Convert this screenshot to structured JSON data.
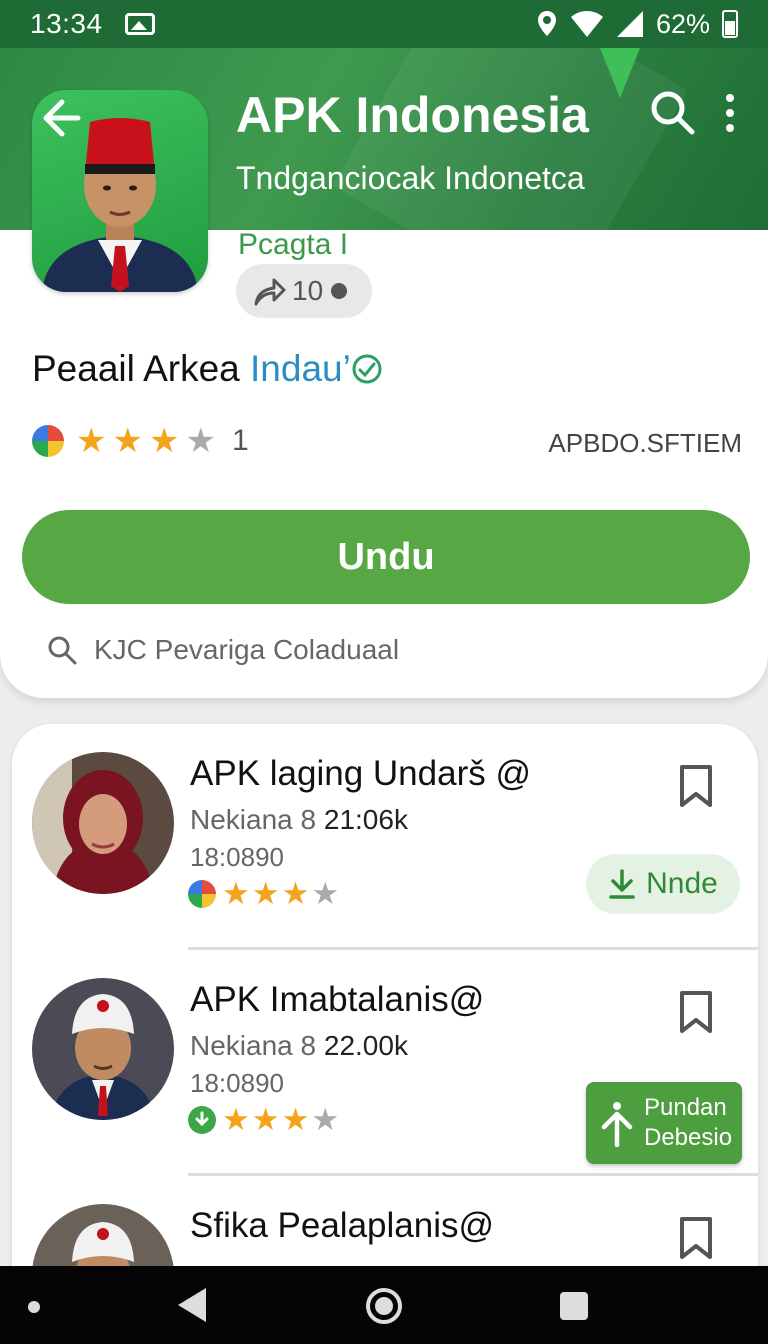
{
  "status_bar": {
    "time": "13:34",
    "battery": "62%"
  },
  "header": {
    "title": "APK Indonesia",
    "subtitle": "Tndganciocak Indonetca",
    "page_label": "Pcagta I"
  },
  "share": {
    "count": "10"
  },
  "app": {
    "developer_prefix": "Peaail Arkea ",
    "developer_accent": "Indau’",
    "rating_stars": 3,
    "rating_count": "1",
    "publisher": "APBDO.SFTIEM",
    "install_label": "Undu",
    "search_text": "KJC Pevariga Coladuaal"
  },
  "list": [
    {
      "title": "APK laging Undarš @",
      "meta_label": "Nekiana 8",
      "meta_value": "21:06k",
      "meta2": "18:0890",
      "stars": 3,
      "action_label": "Nnde"
    },
    {
      "title": "APK Imabtalanis@",
      "meta_label": "Nekiana 8",
      "meta_value": "22.00k",
      "meta2": "18:0890",
      "stars": 3
    },
    {
      "title": "Sfika Pealaplanis@",
      "meta_label": "",
      "meta_value": "",
      "meta2": "",
      "stars": 0
    }
  ],
  "floating_button": {
    "line1": "Pundan",
    "line2": "Debesio"
  },
  "colors": {
    "primary_green": "#57a744",
    "header_green": "#2d8a44",
    "star_yellow": "#f4a31c",
    "accent_blue": "#2a8fc0"
  },
  "icons": [
    "gallery-icon",
    "location-icon",
    "wifi-icon",
    "signal-icon",
    "battery-icon",
    "back-arrow-icon",
    "search-icon",
    "more-vert-icon",
    "share-icon",
    "verified-icon",
    "bookmark-icon",
    "download-icon",
    "upload-icon"
  ]
}
